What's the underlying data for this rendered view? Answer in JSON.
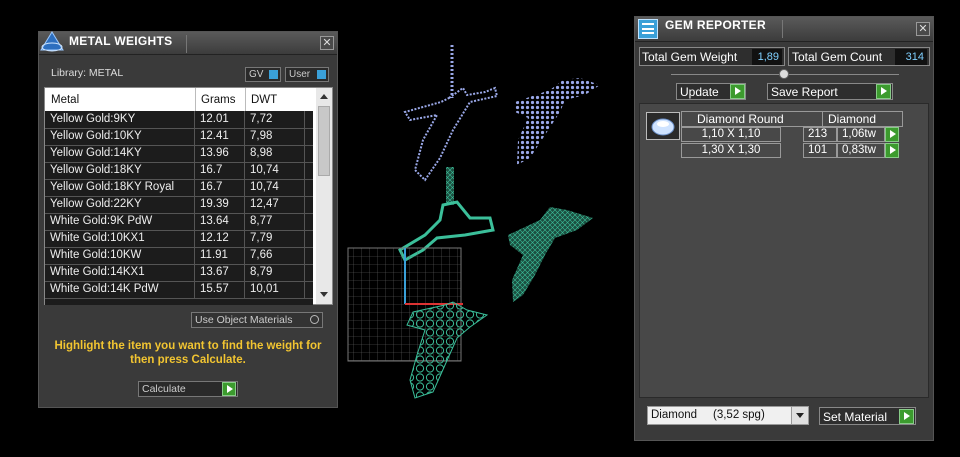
{
  "metal_weights": {
    "title": "METAL WEIGHTS",
    "close": "✕",
    "library_label": "Library: METAL",
    "gv_label": "GV",
    "user_label": "User",
    "columns": [
      "Metal",
      "Grams",
      "DWT"
    ],
    "rows": [
      {
        "metal": "Yellow Gold:9KY",
        "grams": "12.01",
        "dwt": "7,72"
      },
      {
        "metal": "Yellow Gold:10KY",
        "grams": "12.41",
        "dwt": "7,98"
      },
      {
        "metal": "Yellow Gold:14KY",
        "grams": "13.96",
        "dwt": "8,98"
      },
      {
        "metal": "Yellow Gold:18KY",
        "grams": "16.7",
        "dwt": "10,74"
      },
      {
        "metal": "Yellow Gold:18KY Royal",
        "grams": "16.7",
        "dwt": "10,74"
      },
      {
        "metal": "Yellow Gold:22KY",
        "grams": "19.39",
        "dwt": "12,47"
      },
      {
        "metal": "White Gold:9K PdW",
        "grams": "13.64",
        "dwt": "8,77"
      },
      {
        "metal": "White Gold:10KX1",
        "grams": "12.12",
        "dwt": "7,79"
      },
      {
        "metal": "White Gold:10KW",
        "grams": "11.91",
        "dwt": "7,66"
      },
      {
        "metal": "White Gold:14KX1",
        "grams": "13.67",
        "dwt": "8,79"
      },
      {
        "metal": "White Gold:14K PdW",
        "grams": "15.57",
        "dwt": "10,01"
      }
    ],
    "use_object_materials": "Use Object Materials",
    "hint": "Highlight the item you want to find the weight for then press Calculate.",
    "calculate": "Calculate"
  },
  "gem_reporter": {
    "title": "GEM REPORTER",
    "close": "✕",
    "total_weight_label": "Total Gem Weight",
    "total_weight_value": "1,89",
    "total_count_label": "Total Gem Count",
    "total_count_value": "314",
    "update": "Update",
    "save_report": "Save Report",
    "headers": [
      "Diamond Round",
      "Diamond"
    ],
    "gems": [
      {
        "size": "1,10 X 1,10",
        "count": "213",
        "weight": "1,06tw"
      },
      {
        "size": "1,30 X 1,30",
        "count": "101",
        "weight": "0,83tw"
      }
    ],
    "material_select": "Diamond     (3,52 spg)",
    "set_material": "Set Material"
  },
  "colors": {
    "accent_green": "#3c9b2e",
    "value_blue": "#7fd0ff",
    "hint_yellow": "#f2c531",
    "wire_teal": "#3bbf9a",
    "wire_blue": "#9aa8e8"
  }
}
